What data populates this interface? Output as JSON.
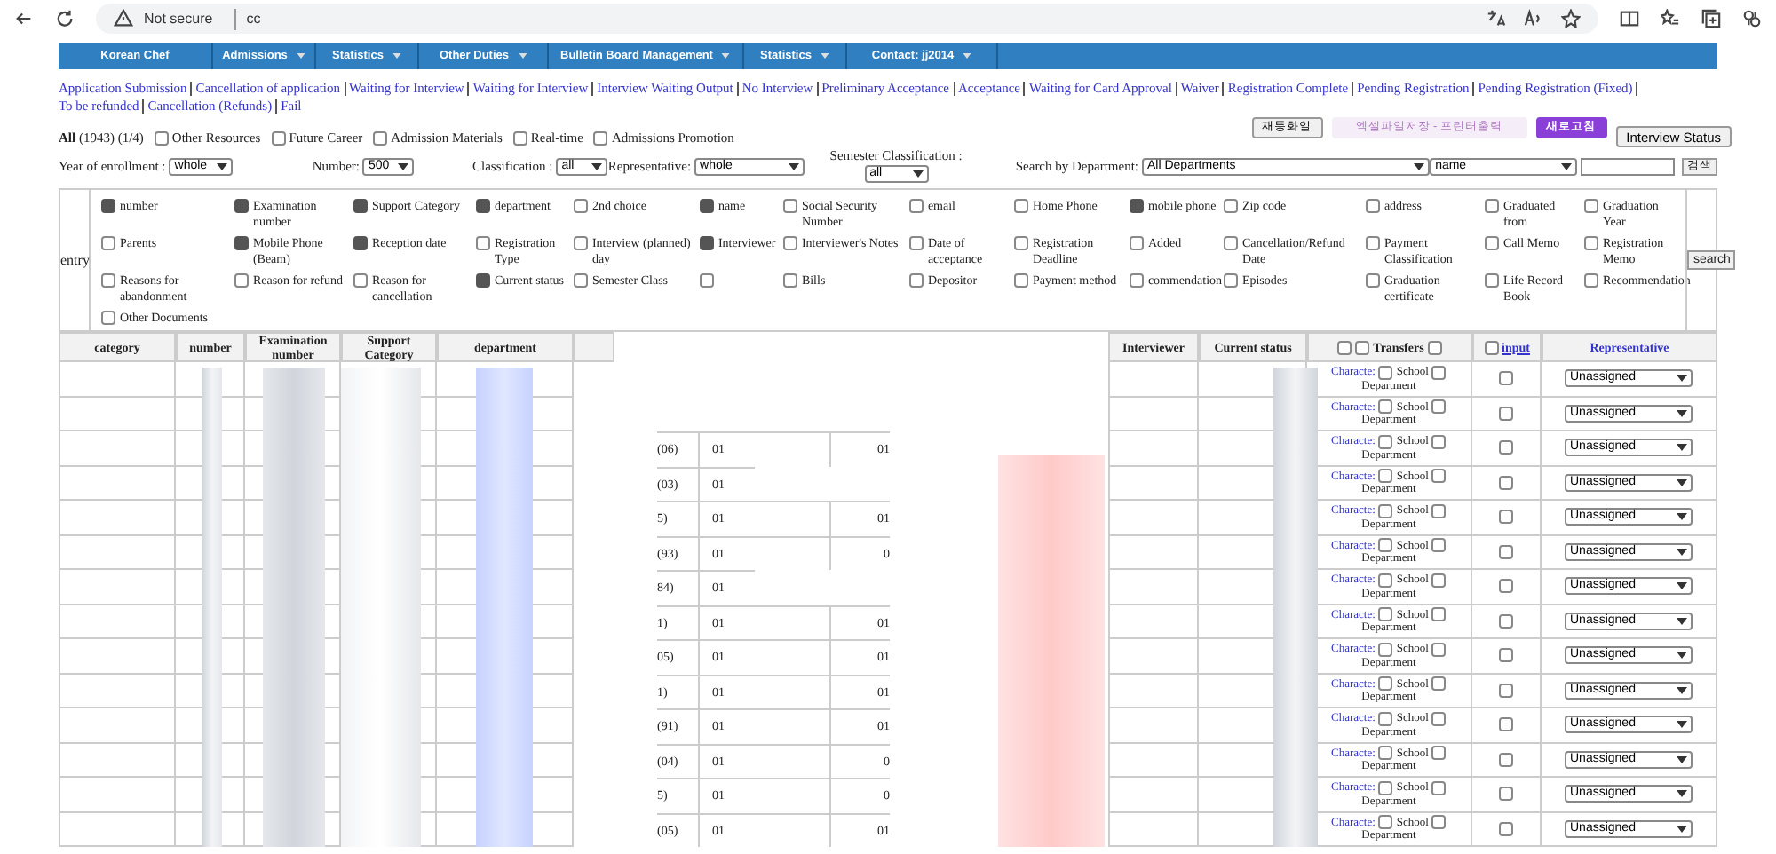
{
  "browser": {
    "security": "Not secure",
    "url": "cc"
  },
  "nav": [
    {
      "label": "Korean Chef",
      "menu": false
    },
    {
      "label": "Admissions",
      "menu": true
    },
    {
      "label": "Statistics",
      "menu": true
    },
    {
      "label": "Other Duties",
      "menu": true
    },
    {
      "label": "Bulletin Board Management",
      "menu": true
    },
    {
      "label": "Statistics",
      "menu": true
    },
    {
      "label": "Contact: jj2014",
      "menu": true
    }
  ],
  "status_links": [
    "Application Submission",
    "Cancellation of application",
    "Waiting for Interview",
    "Waiting for Interview",
    "Interview Waiting Output",
    "No Interview",
    "Preliminary Acceptance",
    "Acceptance",
    "Waiting for Card Approval",
    "Waiver",
    "Registration Complete",
    "Pending Registration",
    "Pending Registration (Fixed)",
    "To be refunded",
    "Cancellation (Refunds)",
    "Fail"
  ],
  "summary": "**All** (1943) (1/4)",
  "filter_checks": [
    {
      "label": "Other Resources",
      "checked": false
    },
    {
      "label": "Future Career",
      "checked": false
    },
    {
      "label": "Admission Materials",
      "checked": false
    },
    {
      "label": "Real-time",
      "checked": false
    },
    {
      "label": "Admissions Promotion",
      "checked": false
    }
  ],
  "action_buttons": [
    {
      "label": "재통화일",
      "kind": "plain"
    },
    {
      "label": "엑셀파일저장 - 프린터출력",
      "kind": "light"
    },
    {
      "label": "새로고침",
      "kind": "dark"
    },
    {
      "label": "Interview Status",
      "kind": "plain"
    }
  ],
  "filters": [
    {
      "label": "Year of enrollment :",
      "value": "whole"
    },
    {
      "label": "Number:",
      "value": "500"
    },
    {
      "label": "Classification :",
      "value": "all"
    },
    {
      "label": "Representative:",
      "value": "whole"
    },
    {
      "label": "Semester Classification :",
      "value": "all"
    },
    {
      "label": "Search by Department:",
      "value": "All Departments"
    }
  ],
  "search": {
    "field": "name",
    "button": "검색"
  },
  "entry": {
    "label": "entry",
    "button": "search",
    "items": [
      {
        "label": "number",
        "checked": true
      },
      {
        "label": "Examination number",
        "checked": true
      },
      {
        "label": "Support Category",
        "checked": true
      },
      {
        "label": "department",
        "checked": true
      },
      {
        "label": "2nd choice",
        "checked": false
      },
      {
        "label": "name",
        "checked": true
      },
      {
        "label": "Social Security Number",
        "checked": false
      },
      {
        "label": "email",
        "checked": false
      },
      {
        "label": "Home Phone",
        "checked": false
      },
      {
        "label": "mobile phone",
        "checked": true
      },
      {
        "label": "Zip code",
        "checked": false
      },
      {
        "label": "address",
        "checked": false
      },
      {
        "label": "Graduated from",
        "checked": false
      },
      {
        "label": "Graduation Year",
        "checked": false
      },
      {
        "label": "Parents",
        "checked": false
      },
      {
        "label": "Mobile Phone (Beam)",
        "checked": true
      },
      {
        "label": "Reception date",
        "checked": true
      },
      {
        "label": "Registration Type",
        "checked": false
      },
      {
        "label": "Interview (planned) day",
        "checked": false
      },
      {
        "label": "Interviewer",
        "checked": true
      },
      {
        "label": "Interviewer's Notes",
        "checked": false
      },
      {
        "label": "Date of acceptance",
        "checked": false
      },
      {
        "label": "Registration Deadline",
        "checked": false
      },
      {
        "label": "Added",
        "checked": false
      },
      {
        "label": "Cancellation/Refund Date",
        "checked": false
      },
      {
        "label": "Payment Classification",
        "checked": false
      },
      {
        "label": "Call Memo",
        "checked": false
      },
      {
        "label": "Registration Memo",
        "checked": false
      },
      {
        "label": "Reasons for abandonment",
        "checked": false
      },
      {
        "label": "Reason for refund",
        "checked": false
      },
      {
        "label": "Reason for cancellation",
        "checked": false
      },
      {
        "label": "Current status",
        "checked": true
      },
      {
        "label": "Semester Class",
        "checked": false
      },
      {
        "checked": false
      },
      {
        "label": "Bills",
        "checked": false
      },
      {
        "label": "Depositor",
        "checked": false
      },
      {
        "label": "Payment method",
        "checked": false
      },
      {
        "label": "commendation",
        "checked": false
      },
      {
        "label": "Episodes",
        "checked": false
      },
      {
        "label": "Graduation certificate",
        "checked": false
      },
      {
        "label": "Life Record Book",
        "checked": false
      },
      {
        "label": "Recommendation",
        "checked": false
      },
      {
        "label": "Other Documents",
        "checked": false
      }
    ]
  },
  "table": {
    "left_columns": [
      "category",
      "number",
      "Examination number",
      "Support Category",
      "department"
    ],
    "right_columns": [
      "Interviewer",
      "Current status"
    ],
    "transfers_header": {
      "label": "Transfers",
      "checks": [
        false,
        false,
        false
      ]
    },
    "input_header": {
      "label": "input",
      "checked": false
    },
    "representative_header": "Representative",
    "rows": [
      {
        "transfer": {
          "link": "Characte:",
          "school": "School",
          "department": "Department",
          "checks": [
            false,
            false
          ]
        },
        "input": false,
        "representative": "Unassigned"
      },
      {
        "transfer": {
          "link": "Characte:",
          "school": "School",
          "department": "Department",
          "checks": [
            false,
            false
          ]
        },
        "input": false,
        "representative": "Unassigned"
      },
      {
        "fragments": [
          "(06)",
          "01",
          "01"
        ],
        "transfer": {
          "link": "Characte:",
          "school": "School",
          "department": "Department",
          "checks": [
            false,
            false
          ]
        },
        "input": false,
        "representative": "Unassigned"
      },
      {
        "fragments": [
          "(03)",
          "01"
        ],
        "transfer": {
          "link": "Characte:",
          "school": "School",
          "department": "Department",
          "checks": [
            false,
            false
          ]
        },
        "input": false,
        "representative": "Unassigned"
      },
      {
        "fragments": [
          "5)",
          "01",
          "01"
        ],
        "transfer": {
          "link": "Characte:",
          "school": "School",
          "department": "Department",
          "checks": [
            false,
            false
          ]
        },
        "input": false,
        "representative": "Unassigned"
      },
      {
        "fragments": [
          "(93)",
          "01",
          "0"
        ],
        "transfer": {
          "link": "Characte:",
          "school": "School",
          "department": "Department",
          "checks": [
            false,
            false
          ]
        },
        "input": false,
        "representative": "Unassigned"
      },
      {
        "fragments": [
          "84)",
          "01"
        ],
        "transfer": {
          "link": "Characte:",
          "school": "School",
          "department": "Department",
          "checks": [
            false,
            false
          ]
        },
        "input": false,
        "representative": "Unassigned"
      },
      {
        "fragments": [
          "1)",
          "01",
          "01"
        ],
        "transfer": {
          "link": "Characte:",
          "school": "School",
          "department": "Department",
          "checks": [
            false,
            false
          ]
        },
        "input": false,
        "representative": "Unassigned"
      },
      {
        "fragments": [
          "05)",
          "01",
          "01"
        ],
        "transfer": {
          "link": "Characte:",
          "school": "School",
          "department": "Department",
          "checks": [
            false,
            false
          ]
        },
        "input": false,
        "representative": "Unassigned"
      },
      {
        "fragments": [
          "1)",
          "01",
          "01"
        ],
        "transfer": {
          "link": "Characte:",
          "school": "School",
          "department": "Department",
          "checks": [
            false,
            false
          ]
        },
        "input": false,
        "representative": "Unassigned"
      },
      {
        "fragments": [
          "(91)",
          "01",
          "01"
        ],
        "transfer": {
          "link": "Characte:",
          "school": "School",
          "department": "Department",
          "checks": [
            false,
            false
          ]
        },
        "input": false,
        "representative": "Unassigned"
      },
      {
        "fragments": [
          "(04)",
          "01",
          "0"
        ],
        "transfer": {
          "link": "Characte:",
          "school": "School",
          "department": "Department",
          "checks": [
            false,
            false
          ]
        },
        "input": false,
        "representative": "Unassigned"
      },
      {
        "fragments": [
          "5)",
          "01",
          "0"
        ],
        "transfer": {
          "link": "Characte:",
          "school": "School",
          "department": "Department",
          "checks": [
            false,
            false
          ]
        },
        "input": false,
        "representative": "Unassigned"
      },
      {
        "fragments": [
          "(05)",
          "01",
          "01"
        ],
        "transfer": {
          "link": "Characte:",
          "school": "School",
          "department": "Department",
          "checks": [
            false,
            false
          ]
        },
        "input": false,
        "representative": "Unassigned"
      }
    ]
  }
}
